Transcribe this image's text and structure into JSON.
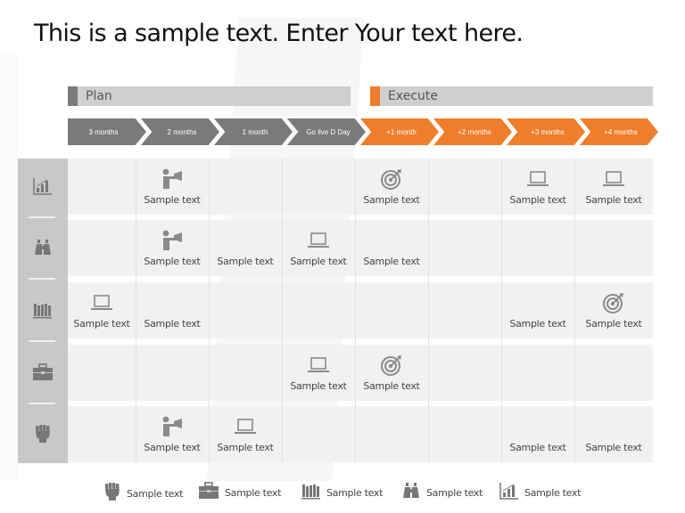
{
  "title": "This is a sample text. Enter Your text here.",
  "colors": {
    "gray_phase": "#7a7a7a",
    "orange_phase": "#ef7d2b",
    "phase_bar": "#d0cfcf",
    "sidebar": "#c8c8c8",
    "icon_gray": "#8a8a8a"
  },
  "phases": [
    {
      "label": "Plan",
      "accent": "gray"
    },
    {
      "label": "Execute",
      "accent": "orange"
    }
  ],
  "timeline": [
    {
      "label": "3 months",
      "phase": "plan"
    },
    {
      "label": "2 months",
      "phase": "plan"
    },
    {
      "label": "1 month",
      "phase": "plan"
    },
    {
      "label": "Go live D Day",
      "phase": "plan"
    },
    {
      "label": "+1 month",
      "phase": "execute"
    },
    {
      "label": "+2 months",
      "phase": "execute"
    },
    {
      "label": "+3 months",
      "phase": "execute"
    },
    {
      "label": "+4 months",
      "phase": "execute"
    }
  ],
  "rows": [
    {
      "row_icon": "bar-chart-icon",
      "cells": [
        null,
        {
          "icon": "presenter-icon",
          "text": "Sample text"
        },
        null,
        null,
        {
          "icon": "target-icon",
          "text": "Sample text"
        },
        null,
        {
          "icon": "laptop-icon",
          "text": "Sample text"
        },
        {
          "icon": "laptop-icon",
          "text": "Sample text"
        }
      ]
    },
    {
      "row_icon": "binoculars-icon",
      "cells": [
        null,
        {
          "icon": "presenter-icon",
          "text": "Sample text"
        },
        {
          "icon": null,
          "text": "Sample text"
        },
        {
          "icon": "laptop-icon",
          "text": "Sample text"
        },
        {
          "icon": null,
          "text": "Sample text"
        },
        null,
        null,
        null
      ]
    },
    {
      "row_icon": "books-icon",
      "cells": [
        {
          "icon": "laptop-icon",
          "text": "Sample text"
        },
        {
          "icon": null,
          "text": "Sample text"
        },
        null,
        null,
        null,
        null,
        {
          "icon": null,
          "text": "Sample text"
        },
        {
          "icon": "target-icon",
          "text": "Sample text"
        }
      ]
    },
    {
      "row_icon": "briefcase-icon",
      "cells": [
        null,
        null,
        null,
        {
          "icon": "laptop-icon",
          "text": "Sample text"
        },
        {
          "icon": "target-icon",
          "text": "Sample text"
        },
        null,
        null,
        null
      ]
    },
    {
      "row_icon": "fist-icon",
      "cells": [
        null,
        {
          "icon": "presenter-icon",
          "text": "Sample text"
        },
        {
          "icon": "laptop-icon",
          "text": "Sample text"
        },
        null,
        null,
        null,
        {
          "icon": null,
          "text": "Sample text"
        },
        {
          "icon": null,
          "text": "Sample text"
        }
      ]
    }
  ],
  "legend": [
    {
      "icon": "fist-icon",
      "text": "Sample text"
    },
    {
      "icon": "briefcase-icon",
      "text": "Sample text"
    },
    {
      "icon": "books-icon",
      "text": "Sample text"
    },
    {
      "icon": "binoculars-icon",
      "text": "Sample text"
    },
    {
      "icon": "bar-chart-icon",
      "text": "Sample text"
    }
  ]
}
